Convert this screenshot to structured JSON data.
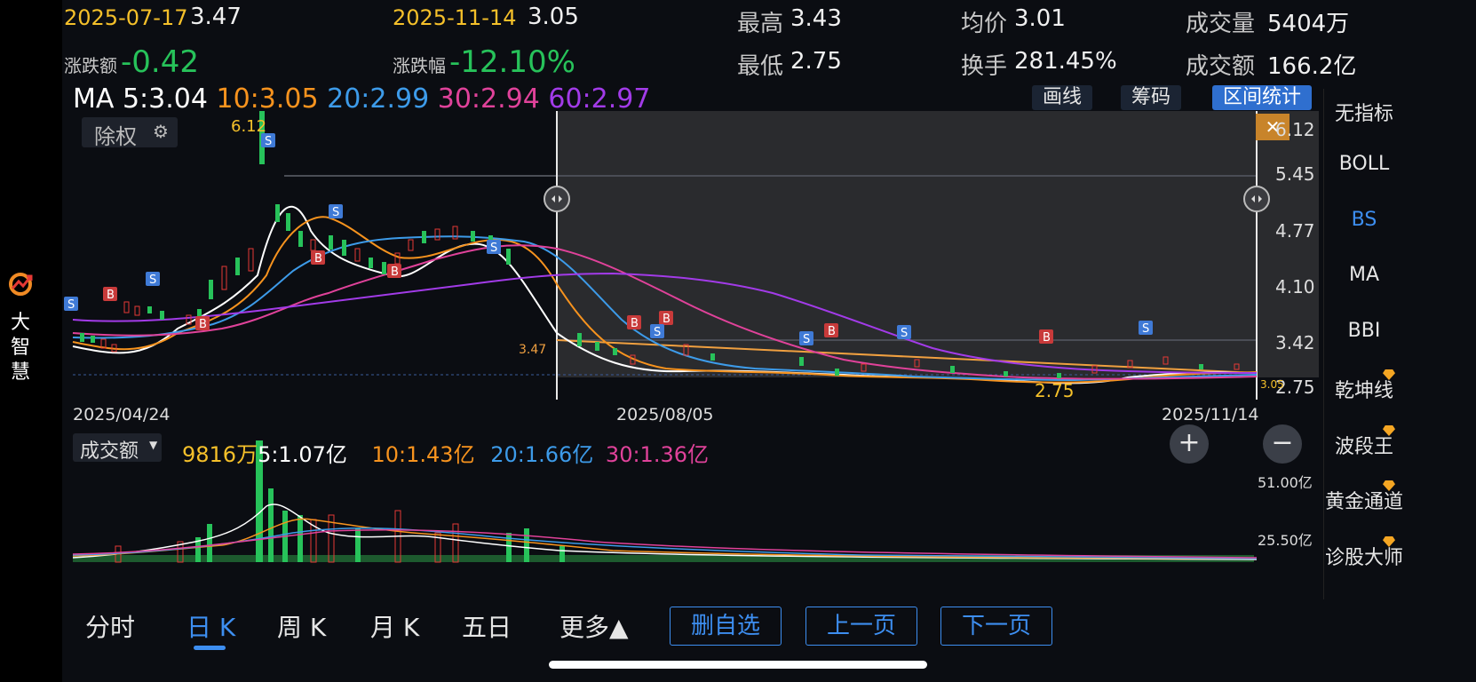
{
  "app": {
    "name_chars": [
      "大",
      "智",
      "慧"
    ]
  },
  "header": {
    "date1": "2025-07-17",
    "price1": "3.47",
    "date2": "2025-11-14",
    "price2": "3.05",
    "high_label": "最高",
    "high": "3.43",
    "avg_label": "均价",
    "avg": "3.01",
    "vol_label": "成交量",
    "vol": "5404万",
    "chg_label": "涨跌额",
    "chg": "-0.42",
    "pct_label": "涨跌幅",
    "pct": "-12.10%",
    "low_label": "最低",
    "low": "2.75",
    "turnover_label": "换手",
    "turnover": "281.45%",
    "amount_label": "成交额",
    "amount": "166.2亿"
  },
  "ma_line": {
    "prefix": "MA",
    "ma5": "5:3.04",
    "ma10": "10:3.05",
    "ma20": "20:2.99",
    "ma30": "30:2.94",
    "ma60": "60:2.97",
    "colors": {
      "ma5": "#ffffff",
      "ma10": "#f7931e",
      "ma20": "#3d9be9",
      "ma30": "#e0429a",
      "ma60": "#a23be8"
    }
  },
  "toolbar": {
    "draw": "画线",
    "chips": "筹码",
    "range": "区间统计",
    "close": "✕"
  },
  "adjust": {
    "label": "除权",
    "icon": "gear-icon"
  },
  "kline": {
    "max_label": "6.12",
    "min_label": "2.75",
    "mark_347": "3.47",
    "y_ticks": [
      "6.12",
      "5.45",
      "4.77",
      "4.10",
      "3.42",
      "2.75"
    ],
    "right_price": "3.05",
    "dates": [
      "2025/04/24",
      "2025/08/05",
      "2025/11/14"
    ]
  },
  "volume": {
    "selector": "成交额",
    "cur": "9816万",
    "ma5": "5:1.07亿",
    "ma10": "10:1.43亿",
    "ma20": "20:1.66亿",
    "ma30": "30:1.36亿",
    "ticks": [
      "51.00亿",
      "25.50亿"
    ]
  },
  "zoom": {
    "in": "+",
    "out": "−"
  },
  "side_menu": [
    {
      "label": "无指标",
      "active": false,
      "gem": false
    },
    {
      "label": "BOLL",
      "active": false,
      "gem": false
    },
    {
      "label": "BS",
      "active": true,
      "gem": false
    },
    {
      "label": "MA",
      "active": false,
      "gem": false
    },
    {
      "label": "BBI",
      "active": false,
      "gem": false
    },
    {
      "label": "乾坤线",
      "active": false,
      "gem": true
    },
    {
      "label": "波段王",
      "active": false,
      "gem": true
    },
    {
      "label": "黄金通道",
      "active": false,
      "gem": true
    },
    {
      "label": "诊股大师",
      "active": false,
      "gem": true
    }
  ],
  "tabs": [
    "分时",
    "日 K",
    "周 K",
    "月 K",
    "五日",
    "更多▲"
  ],
  "actions": {
    "remove": "删自选",
    "prev": "上一页",
    "next": "下一页"
  }
}
